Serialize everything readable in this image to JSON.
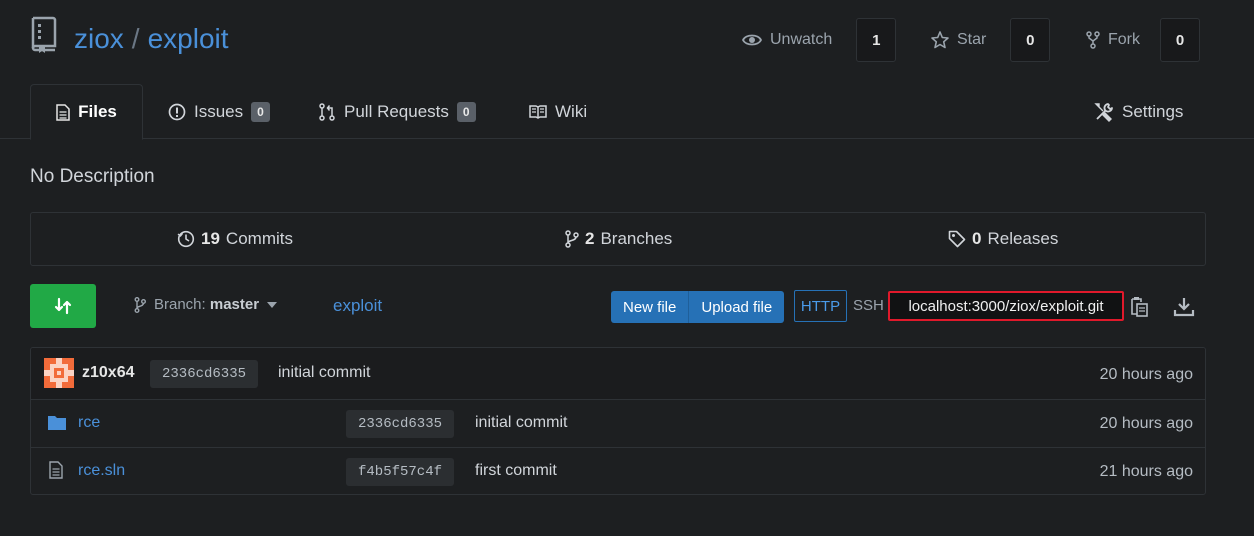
{
  "repo": {
    "owner": "ziox",
    "separator": "/",
    "name": "exploit",
    "description": "No Description"
  },
  "actions": {
    "watch": {
      "label": "Unwatch",
      "count": "1"
    },
    "star": {
      "label": "Star",
      "count": "0"
    },
    "fork": {
      "label": "Fork",
      "count": "0"
    }
  },
  "tabs": [
    {
      "label": "Files",
      "active": true
    },
    {
      "label": "Issues",
      "badge": "0"
    },
    {
      "label": "Pull Requests",
      "badge": "0"
    },
    {
      "label": "Wiki"
    },
    {
      "label": "Settings"
    }
  ],
  "stats": {
    "commits": {
      "count": "19",
      "label": "Commits"
    },
    "branches": {
      "count": "2",
      "label": "Branches"
    },
    "releases": {
      "count": "0",
      "label": "Releases"
    }
  },
  "toolbar": {
    "branch_label": "Branch:",
    "branch_name": "master",
    "path": "exploit",
    "new_file": "New file",
    "upload_file": "Upload file",
    "http": "HTTP",
    "ssh": "SSH",
    "clone_url": "localhost:3000/ziox/exploit.git"
  },
  "latest_commit": {
    "author": "z10x64",
    "sha": "2336cd6335",
    "message": "initial commit",
    "time": "20 hours ago"
  },
  "files": [
    {
      "name": "rce",
      "type": "folder",
      "sha": "2336cd6335",
      "message": "initial commit",
      "time": "20 hours ago"
    },
    {
      "name": "rce.sln",
      "type": "file",
      "sha": "f4b5f57c4f",
      "message": "first commit",
      "time": "21 hours ago"
    }
  ],
  "colors": {
    "background": "#1d1f21",
    "link": "#4a90d9",
    "primary_button": "#2671b6",
    "compare_button": "#21a946",
    "highlight_border": "#e0192b"
  }
}
